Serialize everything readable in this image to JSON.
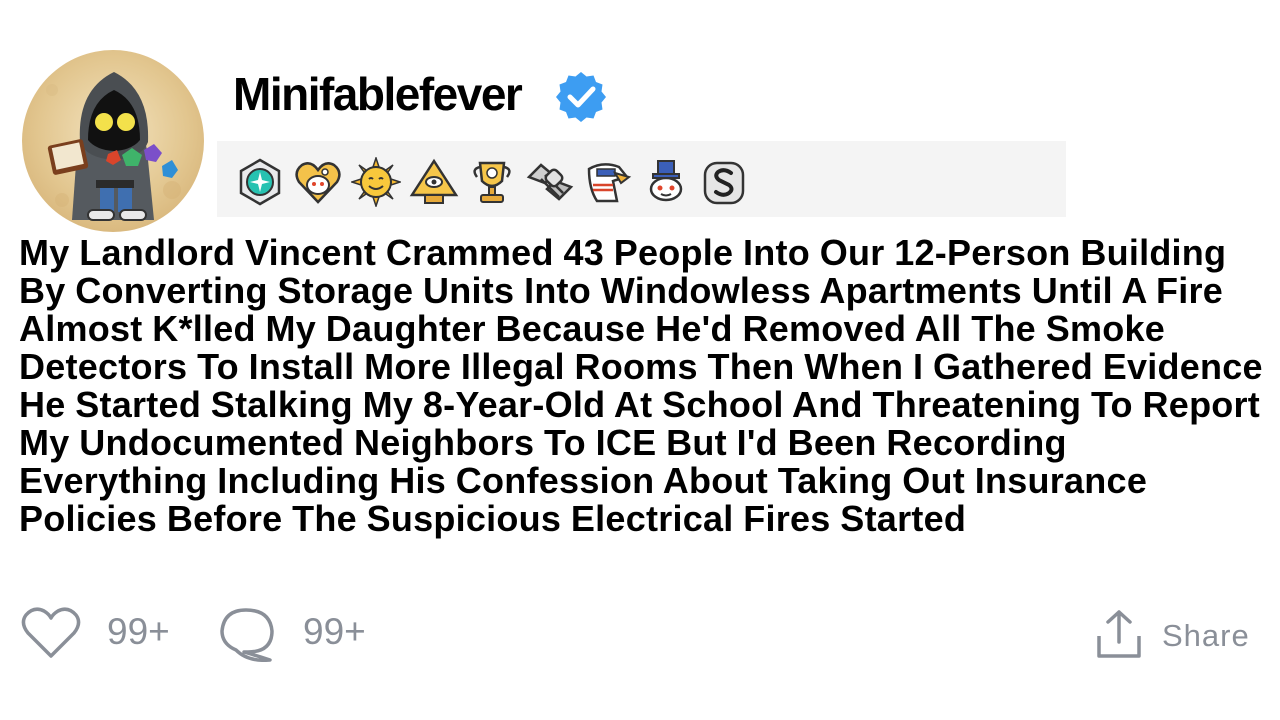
{
  "post": {
    "username": "Minifablefever",
    "title": "My Landlord Vincent Crammed 43 People Into Our 12-Person Building By Converting Storage Units Into Windowless Apartments Until A Fire Almost K*lled My Daughter Because He'd Removed All The Smoke Detectors To Install More Illegal Rooms Then When I Gathered Evidence He Started Stalking My 8-Year-Old At School And Threatening To Report My Undocumented Neighbors To ICE But I'd Been Recording Everything Including His Confession About Taking Out Insurance Policies Before The Suspicious Electrical Fires Started"
  },
  "awards": [
    "platinum-award-icon",
    "wholesome-award-icon",
    "sun-award-icon",
    "illuminati-pyramid-award-icon",
    "gold-trophy-award-icon",
    "handshake-award-icon",
    "american-eagle-award-icon",
    "snoo-tophat-award-icon",
    "silver-s-award-icon"
  ],
  "actions": {
    "likes": "99+",
    "comments": "99+",
    "share_label": "Share"
  },
  "colors": {
    "verified_badge": "#3d9df2",
    "action_gray": "#8a8f98",
    "award_bar_bg": "#f4f4f4"
  }
}
